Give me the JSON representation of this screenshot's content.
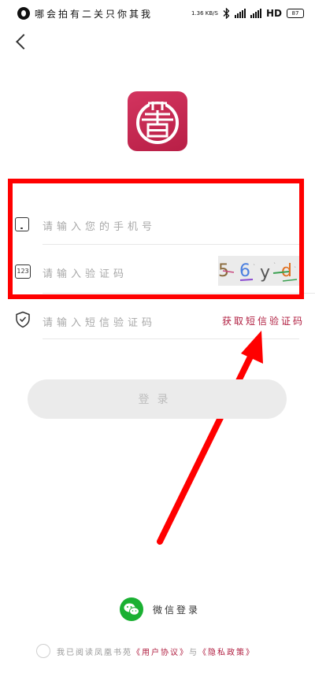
{
  "status_bar": {
    "text": "哪会拍有二关只你其我",
    "speed": "1.36 KB/S",
    "network": "HD",
    "battery": "87"
  },
  "login_form": {
    "phone_placeholder": "请输入您的手机号",
    "captcha_placeholder": "请输入验证码",
    "captcha_image_text": "5 6 y d",
    "sms_placeholder": "请输入短信验证码",
    "get_sms_code_label": "获取短信验证码",
    "login_button_label": "登录"
  },
  "wechat_login_label": "微信登录",
  "agreement": {
    "prefix": "我已阅读凤凰书苑",
    "user_agreement": "《用户协议》",
    "conjunction": "与",
    "privacy_policy": "《隐私政策》"
  },
  "colors": {
    "brand": "#c4274f",
    "annotation": "#ff0000",
    "wechat": "#1ab032"
  },
  "icons": {
    "phone_row": "phone-icon",
    "captcha_row": "digits-123-icon",
    "sms_row": "shield-check-icon",
    "back": "chevron-left-icon",
    "arrow": "red-arrow-icon"
  }
}
